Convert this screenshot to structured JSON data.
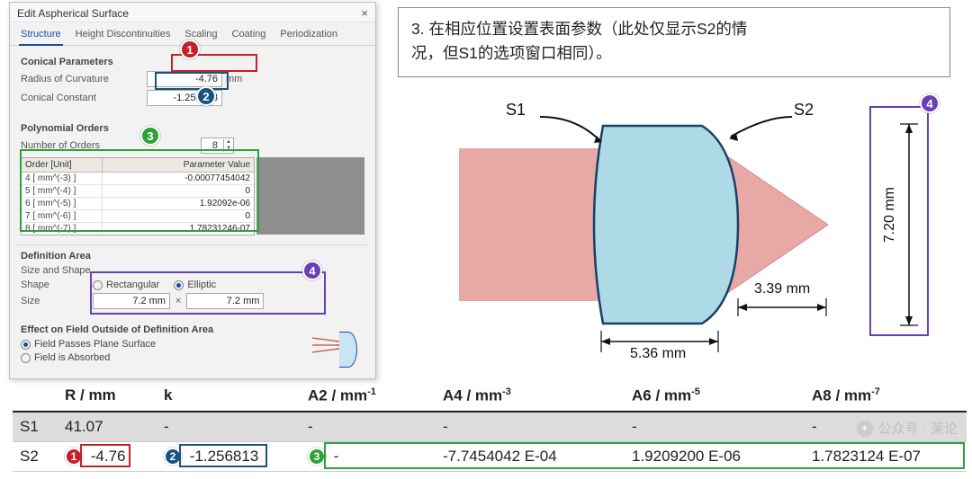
{
  "dialog": {
    "title": "Edit Aspherical Surface",
    "close": "×",
    "tabs": [
      "Structure",
      "Height Discontinuities",
      "Scaling",
      "Coating",
      "Periodization"
    ],
    "active_tab": 0,
    "conical": {
      "title": "Conical Parameters",
      "radius_label": "Radius of Curvature",
      "radius_value": "-4.76",
      "radius_unit": "mm",
      "k_label": "Conical Constant",
      "k_value": "-1.256813"
    },
    "poly": {
      "title": "Polynomial Orders",
      "n_label": "Number of Orders",
      "n_value": "8",
      "grid_h1": "Order [Unit]",
      "grid_h2": "Parameter Value",
      "rows": [
        {
          "u": "4  [ mm^(-3) ]",
          "v": "-0.00077454042"
        },
        {
          "u": "5  [ mm^(-4) ]",
          "v": "0"
        },
        {
          "u": "6  [ mm^(-5) ]",
          "v": "1.92092e-06"
        },
        {
          "u": "7  [ mm^(-6) ]",
          "v": "0"
        },
        {
          "u": "8  [ mm^(-7) ]",
          "v": "1.78231246-07"
        }
      ]
    },
    "area": {
      "title": "Definition Area",
      "sub": "Size and Shape",
      "shape_label": "Shape",
      "shape_rect": "Rectangular",
      "shape_ell": "Elliptic",
      "size_label": "Size",
      "size_x": "7.2 mm",
      "size_y": "7.2 mm"
    },
    "effect": {
      "title": "Effect on Field Outside of Definition Area",
      "opt_pass": "Field Passes Plane Surface",
      "opt_abs": "Field is Absorbed"
    }
  },
  "badges": {
    "b1": "1",
    "b2": "2",
    "b3": "3",
    "b4": "4"
  },
  "caption": {
    "line1": "3. 在相应位置设置表面参数（此处仅显示S2的情",
    "line2": "况，但S1的选项窗口相同）。"
  },
  "figure": {
    "s1": "S1",
    "s2": "S2",
    "w": "5.36 mm",
    "gap": "3.39 mm",
    "h": "7.20 mm"
  },
  "table": {
    "head": [
      "",
      "R / mm",
      "k",
      "A2 / mm",
      "A4 / mm",
      "A6 / mm",
      "A8 / mm"
    ],
    "exp": [
      "",
      "",
      "",
      "-1",
      "-3",
      "-5",
      "-7"
    ],
    "s1": {
      "name": "S1",
      "R": "41.07",
      "k": "-",
      "A2": "-",
      "A4": "-",
      "A6": "-",
      "A8": "-"
    },
    "s2": {
      "name": "S2",
      "R": "-4.76",
      "k": "-1.256813",
      "A2": "-",
      "A4": "-7.7454042 E-04",
      "A6": "1.9209200 E-06",
      "A8": "1.7823124 E-07"
    }
  },
  "watermark": "公众号 · 莱论"
}
